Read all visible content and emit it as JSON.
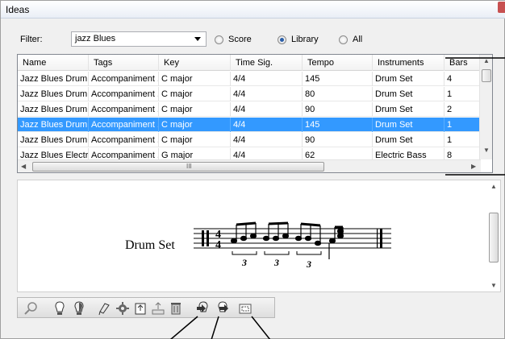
{
  "window": {
    "title": "Ideas"
  },
  "filter": {
    "label": "Filter:",
    "value": "jazz Blues"
  },
  "scope": {
    "options": [
      {
        "label": "Score",
        "checked": false
      },
      {
        "label": "Library",
        "checked": true
      },
      {
        "label": "All",
        "checked": false
      }
    ]
  },
  "table": {
    "columns": [
      "Name",
      "Tags",
      "Key",
      "Time Sig.",
      "Tempo",
      "Instruments",
      "Bars"
    ],
    "rows": [
      [
        "Jazz Blues Drum ...",
        "Accompaniment ...",
        "C major",
        "4/4",
        "145",
        "Drum Set",
        "4"
      ],
      [
        "Jazz Blues Drum ...",
        "Accompaniment ...",
        "C major",
        "4/4",
        "80",
        "Drum Set",
        "1"
      ],
      [
        "Jazz Blues Drum ...",
        "Accompaniment ...",
        "C major",
        "4/4",
        "90",
        "Drum Set",
        "2"
      ],
      [
        "Jazz Blues Drum ...",
        "Accompaniment ...",
        "C major",
        "4/4",
        "145",
        "Drum Set",
        "1"
      ],
      [
        "Jazz Blues Drum ...",
        "Accompaniment ...",
        "C major",
        "4/4",
        "90",
        "Drum Set",
        "1"
      ],
      [
        "Jazz Blues Electri...",
        "Accompaniment ...",
        "G major",
        "4/4",
        "62",
        "Electric Bass",
        "8"
      ]
    ],
    "selected_row": 3,
    "hscroll_grip": "III"
  },
  "preview": {
    "instrument": "Drum Set",
    "time_signature": {
      "top": "4",
      "bottom": "4"
    },
    "tuplets": [
      "3",
      "3",
      "3"
    ]
  },
  "toolbar": {
    "icons": [
      "search-idea-icon",
      "new-idea-icon",
      "capture-idea-icon",
      "edit-idea-icon",
      "settings-icon",
      "import-icon",
      "export-icon",
      "delete-icon",
      "paste-idea-icon",
      "paste-as-tempo-icon",
      "paste-section-icon"
    ]
  },
  "colors": {
    "selection": "#3399ff",
    "accent": "#2a5ea8"
  }
}
